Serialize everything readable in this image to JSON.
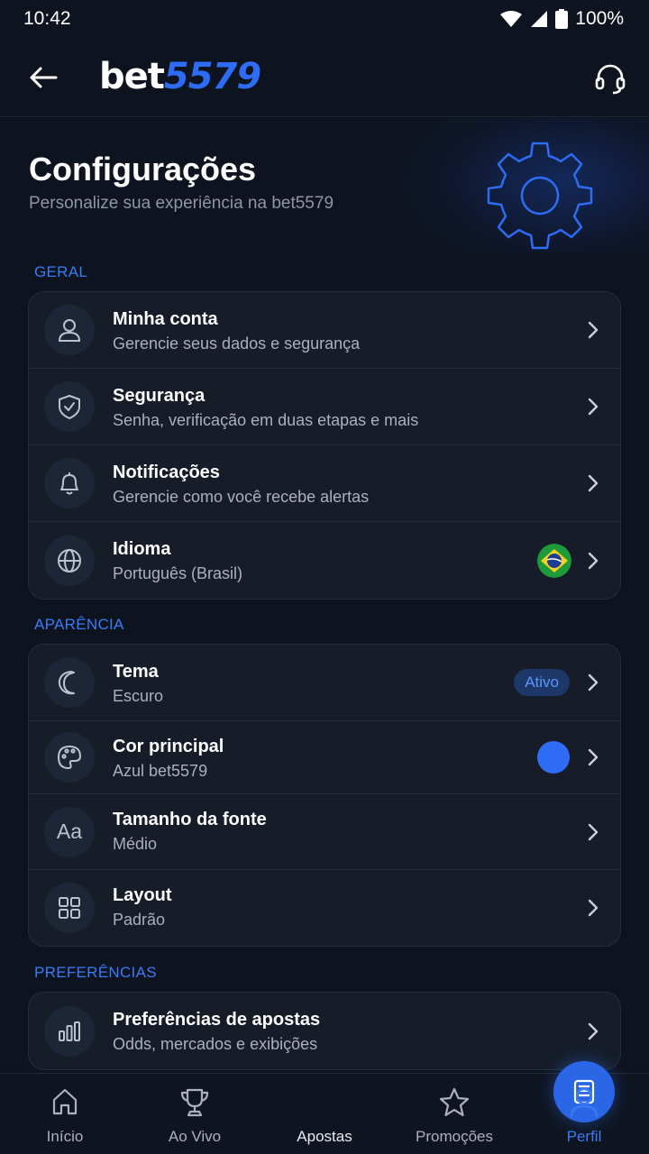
{
  "status_bar": {
    "time": "10:42",
    "battery": "100%"
  },
  "header": {
    "logo_bet": "bet",
    "logo_num": "5579"
  },
  "page": {
    "title": "Configurações",
    "subtitle": "Personalize sua experiência na bet5579"
  },
  "sections": {
    "geral": {
      "label": "GERAL",
      "items": [
        {
          "title": "Minha conta",
          "subtitle": "Gerencie seus dados e segurança",
          "icon": "user-icon"
        },
        {
          "title": "Segurança",
          "subtitle": "Senha, verificação em duas etapas e mais",
          "icon": "shield-check-icon"
        },
        {
          "title": "Notificações",
          "subtitle": "Gerencie como você recebe alertas",
          "icon": "bell-icon"
        },
        {
          "title": "Idioma",
          "subtitle": "Português (Brasil)",
          "icon": "globe-icon"
        }
      ]
    },
    "aparencia": {
      "label": "APARÊNCIA",
      "items": [
        {
          "title": "Tema",
          "subtitle": "Escuro",
          "badge": "Ativo",
          "icon": "moon-icon"
        },
        {
          "title": "Cor principal",
          "subtitle": "Azul bet5579",
          "color": "#2f6cf5",
          "icon": "palette-icon"
        },
        {
          "title": "Tamanho da fonte",
          "subtitle": "Médio",
          "icon": "font-size-icon",
          "icon_text": "Aa"
        },
        {
          "title": "Layout",
          "subtitle": "Padrão",
          "icon": "grid-icon"
        }
      ]
    },
    "preferencias": {
      "label": "PREFERÊNCIAS",
      "items": [
        {
          "title": "Preferências de apostas",
          "subtitle": "Odds, mercados e exibições",
          "icon": "bar-chart-icon"
        }
      ]
    }
  },
  "bottom_nav": {
    "items": [
      {
        "label": "Início",
        "icon": "home-icon"
      },
      {
        "label": "Ao Vivo",
        "icon": "trophy-icon"
      },
      {
        "label": "Apostas",
        "icon": "ticket-icon"
      },
      {
        "label": "Promoções",
        "icon": "star-icon"
      },
      {
        "label": "Perfil",
        "icon": "person-icon",
        "active": true
      }
    ]
  },
  "colors": {
    "accent": "#2f6cf5",
    "background": "#0e141f",
    "card": "#161d29"
  }
}
